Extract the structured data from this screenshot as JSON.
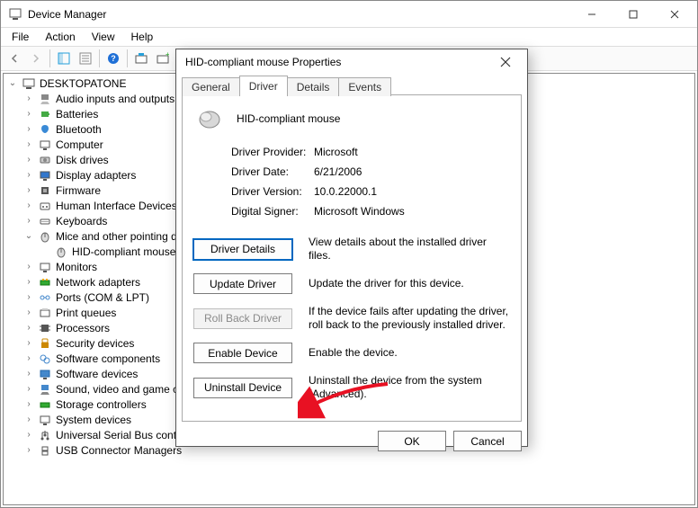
{
  "window": {
    "title": "Device Manager"
  },
  "menu": {
    "file": "File",
    "action": "Action",
    "view": "View",
    "help": "Help"
  },
  "tree": {
    "root": "DESKTOPATONE",
    "items": [
      "Audio inputs and outputs",
      "Batteries",
      "Bluetooth",
      "Computer",
      "Disk drives",
      "Display adapters",
      "Firmware",
      "Human Interface Devices",
      "Keyboards",
      "Mice and other pointing devices",
      "Monitors",
      "Network adapters",
      "Ports (COM & LPT)",
      "Print queues",
      "Processors",
      "Security devices",
      "Software components",
      "Software devices",
      "Sound, video and game controllers",
      "Storage controllers",
      "System devices",
      "Universal Serial Bus controllers",
      "USB Connector Managers"
    ],
    "mice_child": "HID-compliant mouse"
  },
  "dialog": {
    "title": "HID-compliant mouse Properties",
    "tabs": {
      "general": "General",
      "driver": "Driver",
      "details": "Details",
      "events": "Events"
    },
    "device_name": "HID-compliant mouse",
    "info": {
      "provider_k": "Driver Provider:",
      "provider_v": "Microsoft",
      "date_k": "Driver Date:",
      "date_v": "6/21/2006",
      "version_k": "Driver Version:",
      "version_v": "10.0.22000.1",
      "signer_k": "Digital Signer:",
      "signer_v": "Microsoft Windows"
    },
    "buttons": {
      "details": "Driver Details",
      "details_desc": "View details about the installed driver files.",
      "update": "Update Driver",
      "update_desc": "Update the driver for this device.",
      "rollback": "Roll Back Driver",
      "rollback_desc": "If the device fails after updating the driver, roll back to the previously installed driver.",
      "enable": "Enable Device",
      "enable_desc": "Enable the device.",
      "uninstall": "Uninstall Device",
      "uninstall_desc": "Uninstall the device from the system (Advanced)."
    },
    "ok": "OK",
    "cancel": "Cancel"
  }
}
